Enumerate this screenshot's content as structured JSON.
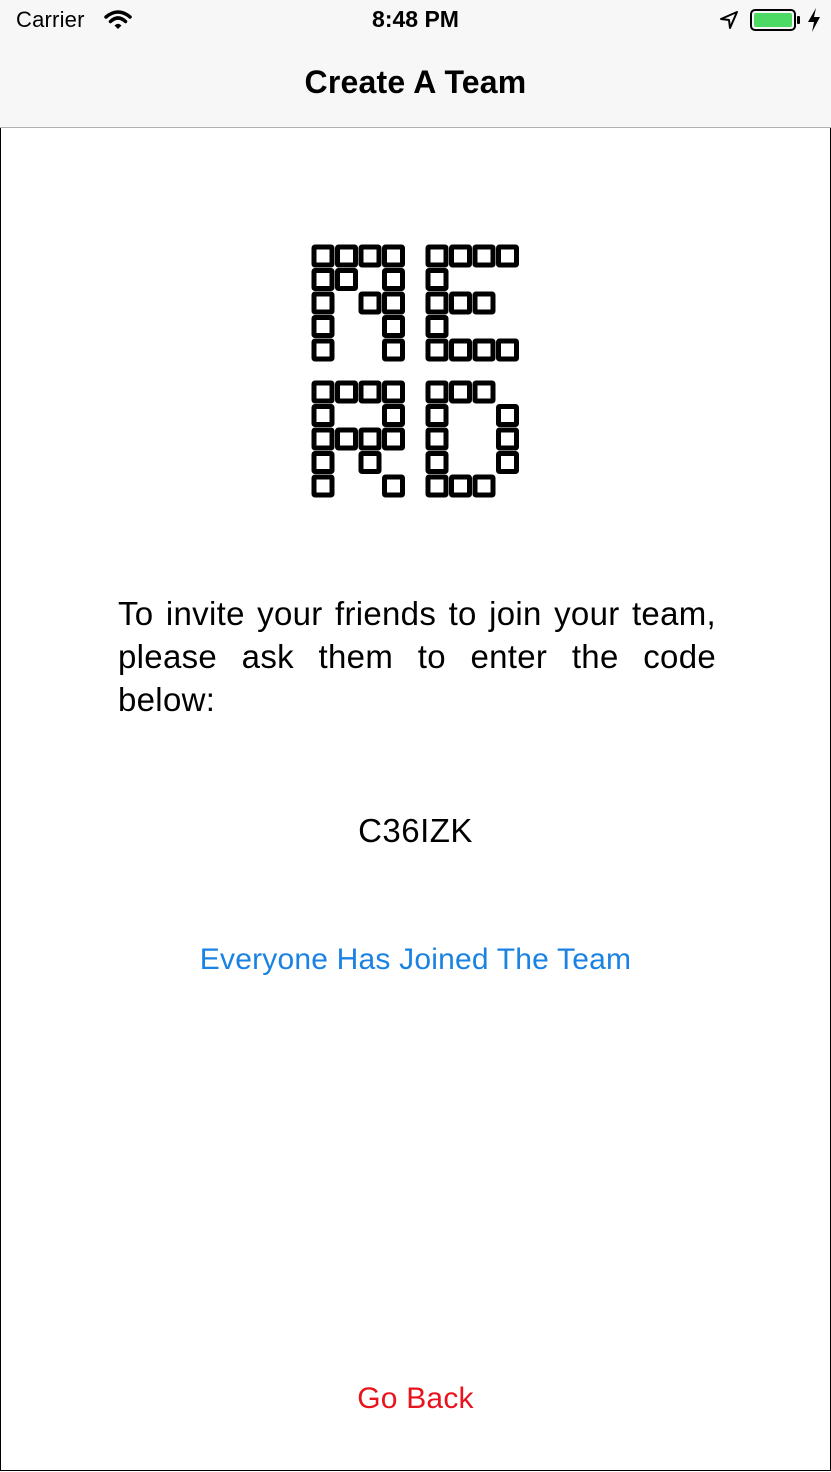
{
  "status_bar": {
    "carrier": "Carrier",
    "time": "8:48 PM",
    "icons": [
      "wifi-icon",
      "location-icon",
      "battery-icon",
      "charging-icon"
    ],
    "battery_color": "#4cd964"
  },
  "nav": {
    "title": "Create A Team"
  },
  "logo": {
    "icon": "nerd-grid-logo",
    "letters": "NERD"
  },
  "content": {
    "instructions": "To invite your friends to join your team, please ask them to enter the code below:",
    "team_code": "C36IZK",
    "joined_button": "Everyone Has Joined The Team",
    "go_back_button": "Go Back"
  },
  "colors": {
    "accent_blue": "#1a82e2",
    "destructive_red": "#e8131c",
    "bar_background": "#f7f7f7"
  }
}
